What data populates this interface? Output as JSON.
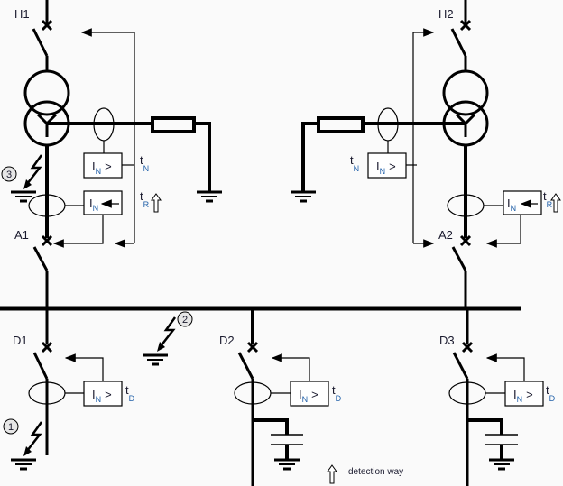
{
  "diagram": {
    "breakers": {
      "h1": "H1",
      "h2": "H2",
      "a1": "A1",
      "a2": "A2",
      "d1": "D1",
      "d2": "D2",
      "d3": "D3"
    },
    "relays": {
      "neutral_overcurrent": {
        "symbol": "I",
        "subscript": "N",
        "suffix": ">"
      },
      "directional": {
        "symbol": "I",
        "subscript": "N"
      }
    },
    "timers": {
      "t_n": {
        "symbol": "t",
        "subscript": "N"
      },
      "t_r": {
        "symbol": "t",
        "subscript": "R"
      },
      "t_d": {
        "symbol": "t",
        "subscript": "D"
      }
    },
    "faults": [
      "1",
      "2",
      "3"
    ],
    "legend": {
      "icon": "hollow-up-arrow-icon",
      "label": "detection way"
    },
    "colors": {
      "line": "#000000",
      "label_accent": "#1f5fa8",
      "background": "#fafafa"
    }
  }
}
